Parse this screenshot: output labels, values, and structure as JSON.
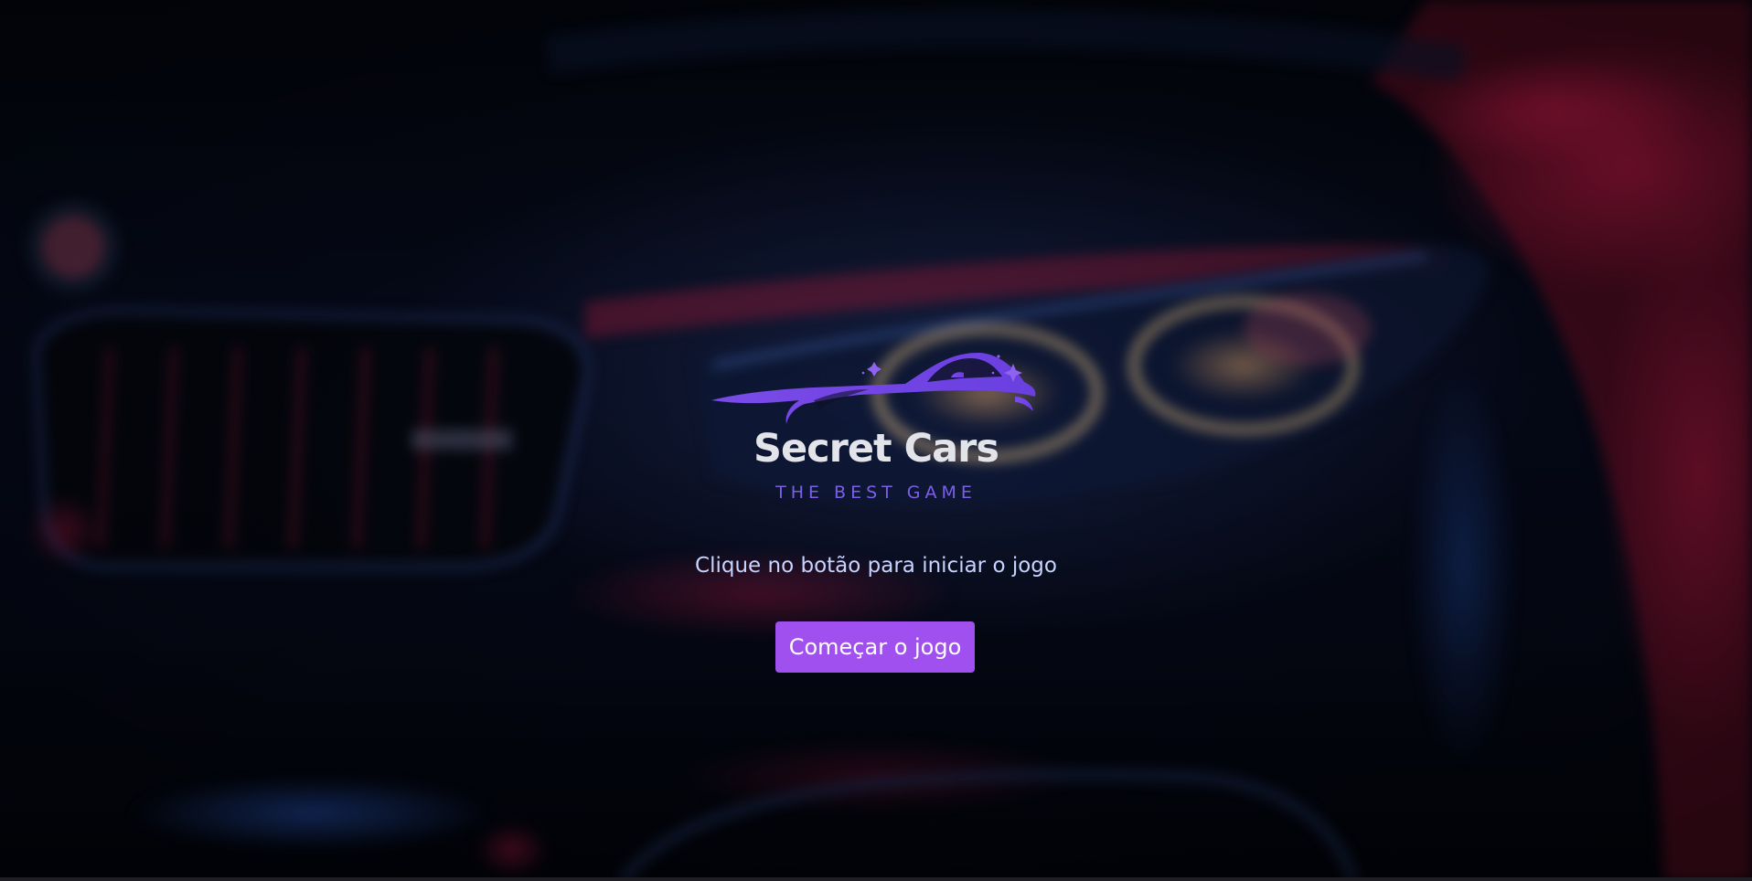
{
  "brand": {
    "title": "Secret Cars",
    "subtitle": "THE BEST GAME"
  },
  "intro": {
    "instruction": "Clique no botão para iniciar o jogo",
    "start_label": "Começar o jogo"
  },
  "colors": {
    "accent": "#a150f0",
    "logo_purple": "#7b4fe6",
    "title_text": "#e3e3ea",
    "instruction_text": "#c6d4ff"
  },
  "icons": {
    "logo": "car-silhouette-icon",
    "background": "car-headlight-photo"
  }
}
